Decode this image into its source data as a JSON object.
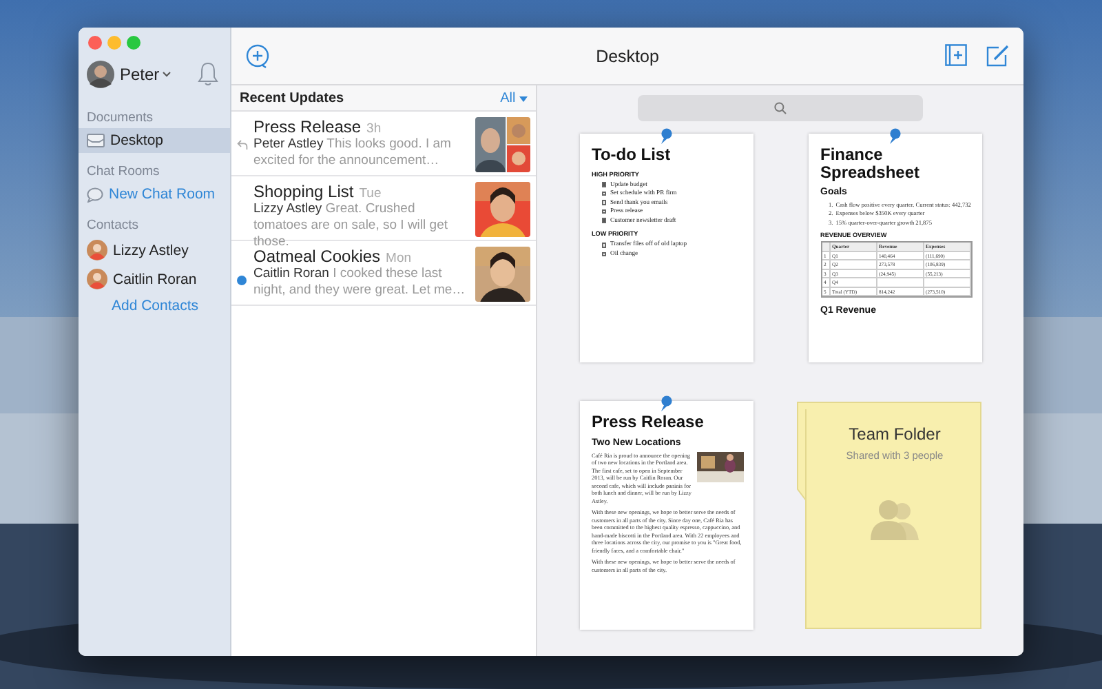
{
  "window": {
    "title": "Desktop"
  },
  "user": {
    "name": "Peter"
  },
  "sidebar": {
    "sections": [
      {
        "heading": "Documents",
        "items": [
          {
            "kind": "folder",
            "label": "Desktop",
            "selected": true
          }
        ]
      },
      {
        "heading": "Chat Rooms",
        "items": [
          {
            "kind": "chat",
            "label": "New Chat Room",
            "selected": false
          }
        ]
      },
      {
        "heading": "Contacts",
        "items": [
          {
            "kind": "contact",
            "label": "Lizzy Astley",
            "selected": false
          },
          {
            "kind": "contact",
            "label": "Caitlin Roran",
            "selected": false
          },
          {
            "kind": "link",
            "label": "Add Contacts",
            "selected": false
          }
        ]
      }
    ]
  },
  "updates": {
    "heading": "Recent Updates",
    "filter": "All",
    "items": [
      {
        "title": "Press Release",
        "time": "3h",
        "author": "Peter Astley",
        "message": "This looks good. I am excited for the announcement…",
        "replied": true,
        "unread": false,
        "kind": "collage"
      },
      {
        "title": "Shopping List",
        "time": "Tue",
        "author": "Lizzy Astley",
        "message": "Great. Crushed tomatoes are on sale, so I will get those.",
        "replied": false,
        "unread": false,
        "kind": "single"
      },
      {
        "title": "Oatmeal Cookies",
        "time": "Mon",
        "author": "Caitlin Roran",
        "message": "I cooked these last night, and they were great. Let me…",
        "replied": false,
        "unread": true,
        "kind": "single"
      }
    ]
  },
  "documents": [
    {
      "kind": "todo",
      "title": "To-do List",
      "pinned": true,
      "groups": [
        {
          "heading": "HIGH PRIORITY",
          "tasks": [
            {
              "text": "Update budget",
              "checked": true
            },
            {
              "text": "Set schedule with PR firm",
              "checked": false
            },
            {
              "text": "Send thank you emails",
              "checked": false
            },
            {
              "text": "Press release",
              "checked": false
            },
            {
              "text": "Customer newsletter draft",
              "checked": true
            }
          ]
        },
        {
          "heading": "LOW PRIORITY",
          "tasks": [
            {
              "text": "Transfer files off of old laptop",
              "checked": false
            },
            {
              "text": "Oil change",
              "checked": false
            }
          ]
        }
      ]
    },
    {
      "kind": "spreadsheet",
      "title": "Finance Spreadsheet",
      "pinned": true,
      "goals_heading": "Goals",
      "goals": [
        {
          "number": "1.",
          "text": "Cash flow positive every quarter. Current status: 442,732"
        },
        {
          "number": "2.",
          "text": "Expenses below $350K every quarter"
        },
        {
          "number": "3.",
          "text": "15% quarter-over-quarter growth 21,875"
        }
      ],
      "table_heading": "REVENUE OVERVIEW",
      "columns": [
        "",
        "Quarter",
        "Revenue",
        "Expenses"
      ],
      "rows": [
        [
          "1",
          "Q1",
          "140,464",
          "(111,690)"
        ],
        [
          "2",
          "Q2",
          "273,578",
          "(106,839)"
        ],
        [
          "3",
          "Q3",
          "(24,945)",
          "(55,213)"
        ],
        [
          "4",
          "Q4"
        ],
        [
          "5",
          "Total (YTD)",
          "814,242",
          "(273,510)"
        ]
      ],
      "chart_heading": "Q1 Revenue"
    },
    {
      "kind": "press",
      "title": "Press Release",
      "pinned": true,
      "subtitle": "Two New Locations",
      "paragraphs": [
        "Café Ria is proud to announce the opening of two new locations in the Portland area. The first cafe, set to open in September 2013, will be run by Caitlin Roran. Our second cafe, which will include paninis for both lunch and dinner, will be run by Lizzy Astley.",
        "With these new openings, we hope to better serve the needs of customers in all parts of the city. Since day one, Café Ria has been committed to the highest quality espresso, cappuccino, and hand-made biscotti in the Portland area. With 22 employees and three locations across the city, our promise to you is \"Great food, friendly faces, and a comfortable chair.\"",
        "With these new openings, we hope to better serve the needs of customers in all parts of the city."
      ]
    },
    {
      "kind": "folder",
      "title": "Team Folder",
      "subtitle": "Shared with 3 people",
      "pinned": false
    }
  ]
}
